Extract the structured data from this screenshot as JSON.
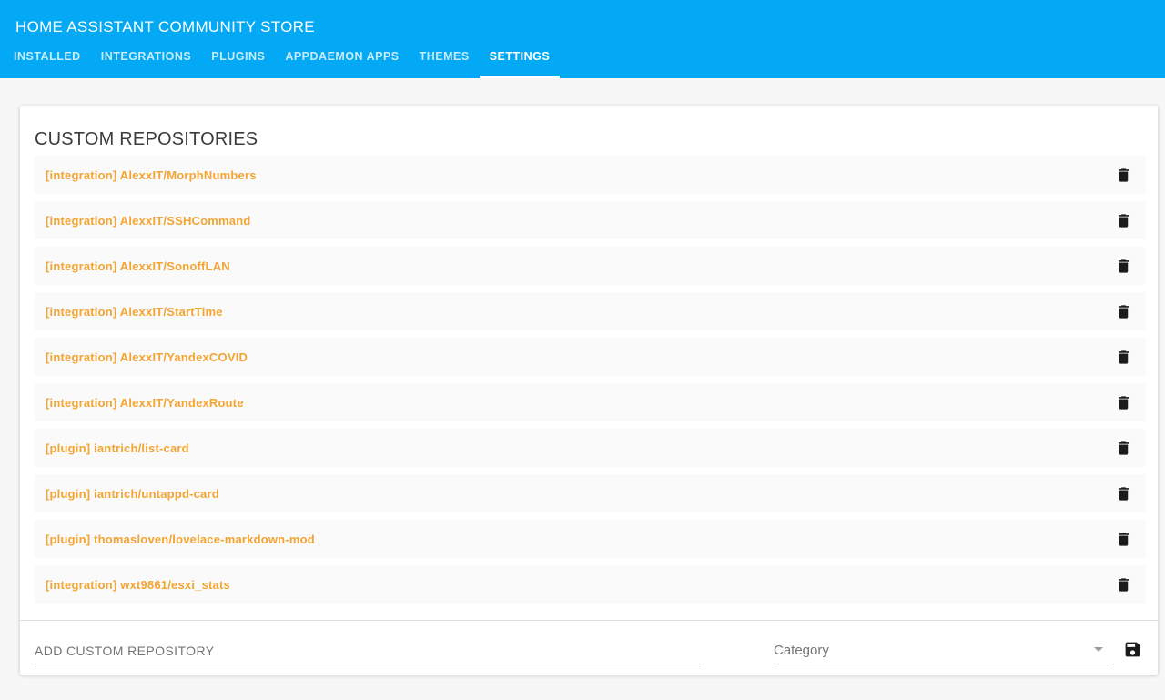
{
  "header": {
    "title": "HOME ASSISTANT COMMUNITY STORE",
    "tabs": [
      {
        "label": "INSTALLED",
        "active": false
      },
      {
        "label": "INTEGRATIONS",
        "active": false
      },
      {
        "label": "PLUGINS",
        "active": false
      },
      {
        "label": "APPDAEMON APPS",
        "active": false
      },
      {
        "label": "THEMES",
        "active": false
      },
      {
        "label": "SETTINGS",
        "active": true
      }
    ]
  },
  "main": {
    "section_title": "CUSTOM REPOSITORIES",
    "repositories": [
      "[integration] AlexxIT/MorphNumbers",
      "[integration] AlexxIT/SSHCommand",
      "[integration] AlexxIT/SonoffLAN",
      "[integration] AlexxIT/StartTime",
      "[integration] AlexxIT/YandexCOVID",
      "[integration] AlexxIT/YandexRoute",
      "[plugin] iantrich/list-card",
      "[plugin] iantrich/untappd-card",
      "[plugin] thomasloven/lovelace-markdown-mod",
      "[integration] wxt9861/esxi_stats"
    ],
    "row_delete_icon": "trash-icon",
    "add_form": {
      "repo_placeholder": "ADD CUSTOM REPOSITORY",
      "repo_value": "",
      "category_label": "Category",
      "category_caret_icon": "caret-down-icon",
      "save_icon": "floppy-disk-icon"
    }
  },
  "colors": {
    "header_bg": "#03a9f4",
    "repo_link": "#f4a431",
    "page_bg": "#f7f7f7",
    "card_bg": "#ffffff",
    "row_bg": "#fafafa",
    "icon_color": "#1b1b1b",
    "muted_text": "#757575",
    "heading_text": "#3c3c3c"
  }
}
